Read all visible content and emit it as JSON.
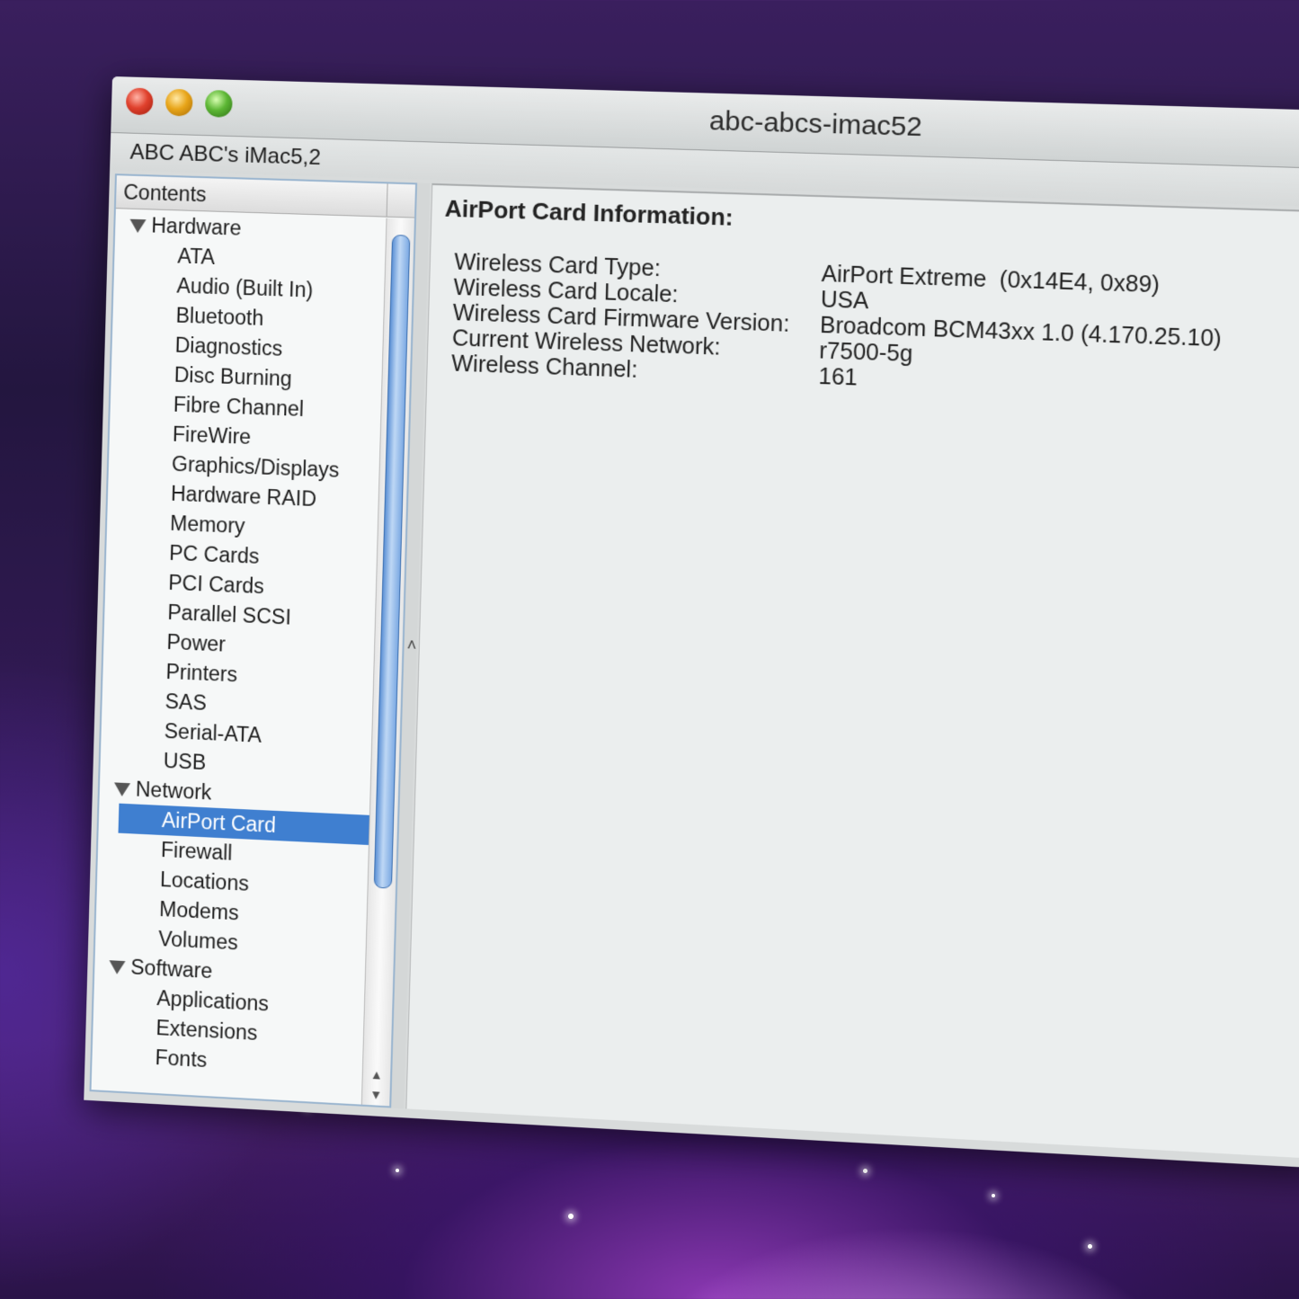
{
  "window": {
    "title": "abc-abcs-imac52",
    "machine_name": "ABC ABC's iMac5,2"
  },
  "sidebar": {
    "header": "Contents",
    "groups": [
      {
        "label": "Hardware",
        "items": [
          "ATA",
          "Audio (Built In)",
          "Bluetooth",
          "Diagnostics",
          "Disc Burning",
          "Fibre Channel",
          "FireWire",
          "Graphics/Displays",
          "Hardware RAID",
          "Memory",
          "PC Cards",
          "PCI Cards",
          "Parallel SCSI",
          "Power",
          "Printers",
          "SAS",
          "Serial-ATA",
          "USB"
        ]
      },
      {
        "label": "Network",
        "items": [
          "AirPort Card",
          "Firewall",
          "Locations",
          "Modems",
          "Volumes"
        ],
        "selected": "AirPort Card"
      },
      {
        "label": "Software",
        "items": [
          "Applications",
          "Extensions",
          "Fonts"
        ]
      }
    ]
  },
  "detail": {
    "title": "AirPort Card Information:",
    "rows": [
      {
        "label": "Wireless Card Type:",
        "value": "AirPort Extreme  (0x14E4, 0x89)"
      },
      {
        "label": "Wireless Card Locale:",
        "value": "USA"
      },
      {
        "label": "Wireless Card Firmware Version:",
        "value": "Broadcom BCM43xx 1.0 (4.170.25.10)"
      },
      {
        "label": "Current Wireless Network:",
        "value": "r7500-5g"
      },
      {
        "label": "Wireless Channel:",
        "value": "161"
      }
    ]
  },
  "colors": {
    "selection": "#3f7fd0",
    "close": "#e0412d",
    "minimize": "#e8a519",
    "zoom": "#5cb634"
  }
}
